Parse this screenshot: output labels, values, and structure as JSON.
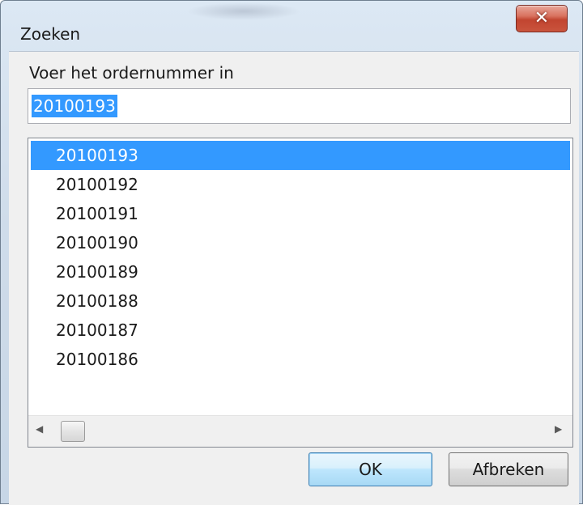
{
  "window": {
    "title": "Zoeken",
    "close_glyph": "✕",
    "close_icon": "close-icon"
  },
  "prompt": {
    "label": "Voer het ordernummer in",
    "value": "20100193"
  },
  "list": {
    "items": [
      "20100193",
      "20100192",
      "20100191",
      "20100190",
      "20100189",
      "20100188",
      "20100187",
      "20100186"
    ],
    "selected_index": 0,
    "scroll_left_glyph": "◀",
    "scroll_right_glyph": "▶"
  },
  "buttons": {
    "ok_label": "OK",
    "cancel_label": "Afbreken"
  },
  "colors": {
    "selection": "#3399ff",
    "close_button": "#c24530"
  }
}
